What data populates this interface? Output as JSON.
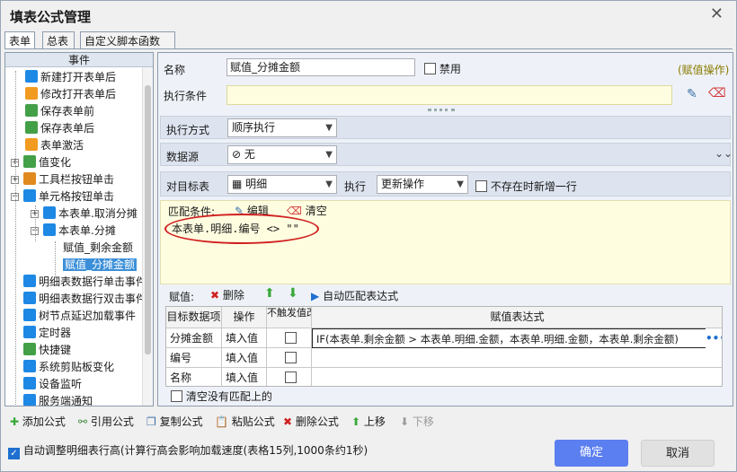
{
  "window": {
    "title": "填表公式管理",
    "close": "✕"
  },
  "tabs": [
    "表单",
    "总表",
    "自定义脚本函数"
  ],
  "left_panel": {
    "header": "事件",
    "items": [
      {
        "label": "新建打开表单后",
        "color": "#1e88e5"
      },
      {
        "label": "修改打开表单后",
        "color": "#f29b21"
      },
      {
        "label": "保存表单前",
        "color": "#43a047"
      },
      {
        "label": "保存表单后",
        "color": "#43a047"
      },
      {
        "label": "表单激活",
        "color": "#f29b21"
      },
      {
        "label": "值变化",
        "color": "#43a047",
        "badge": "123"
      },
      {
        "label": "工具栏按钮单击",
        "color": "#e08a1e"
      },
      {
        "label": "单元格按钮单击",
        "color": "#1e88e5"
      },
      {
        "label": "本表单.取消分摊",
        "color": "#1e88e5"
      },
      {
        "label": "本表单.分摊",
        "color": "#1e88e5"
      },
      {
        "label": "赋值_剩余金额"
      },
      {
        "label": "赋值_分摊金额"
      },
      {
        "label": "明细表数据行单击事件",
        "color": "#1e88e5"
      },
      {
        "label": "明细表数据行双击事件",
        "color": "#1e88e5"
      },
      {
        "label": "树节点延迟加载事件",
        "color": "#1e88e5"
      },
      {
        "label": "定时器",
        "color": "#1e88e5"
      },
      {
        "label": "快捷键",
        "color": "#43a047"
      },
      {
        "label": "系统剪贴板变化",
        "color": "#1e88e5"
      },
      {
        "label": "设备监听",
        "color": "#1e88e5"
      },
      {
        "label": "服务端通知",
        "color": "#1e88e5"
      }
    ]
  },
  "form": {
    "name_label": "名称",
    "name_value": "赋值_分摊金额",
    "disable_label": "禁用",
    "op_type": "(赋值操作)",
    "cond_label": "执行条件",
    "cond_value": "",
    "exec_label": "执行方式",
    "exec_value": "顺序执行",
    "ds_label": "数据源",
    "ds_value": "无",
    "target_label": "对目标表",
    "target_value": "明细",
    "do_label": "执行",
    "do_value": "更新操作",
    "add_row_label": "不存在时新增一行",
    "match_label": "匹配条件:",
    "edit_label": "编辑",
    "clear_label": "清空",
    "match_expr": "本表单.明细.编号 <> \"\"",
    "assign_label": "赋值:",
    "delete_label": "删除",
    "auto_match_label": "自动匹配表达式",
    "clear_unmatched_label": "清空没有匹配上的"
  },
  "grid": {
    "headers": [
      "目标数据项",
      "操作",
      "不触发值改变",
      "赋值表达式"
    ],
    "rows": [
      {
        "field": "分摊金额",
        "op": "填入值",
        "expr": "IF(本表单.剩余金额 > 本表单.明细.金额，本表单.明细.金额，本表单.剩余金额)"
      },
      {
        "field": "编号",
        "op": "填入值",
        "expr": ""
      },
      {
        "field": "名称",
        "op": "填入值",
        "expr": ""
      }
    ]
  },
  "toolbar": {
    "add": "添加公式",
    "ref": "引用公式",
    "copy": "复制公式",
    "paste": "粘贴公式",
    "del": "删除公式",
    "up": "上移",
    "down": "下移"
  },
  "footer": {
    "auto_adjust": "自动调整明细表行高(计算行高会影响加载速度(表格15列,1000条约1秒)",
    "ok": "确定",
    "cancel": "取消"
  }
}
